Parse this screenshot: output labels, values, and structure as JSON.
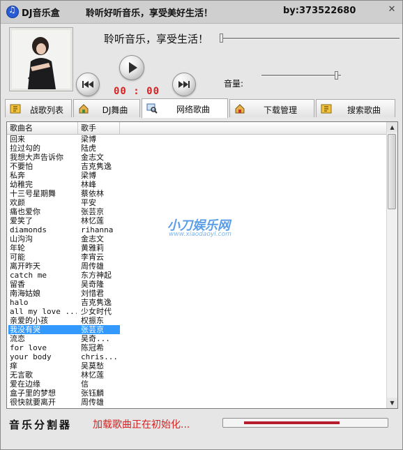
{
  "titlebar": {
    "app_title": "DJ音乐盒",
    "slogan": "聆听好听音乐，享受美好生活！",
    "author": "by:373522680",
    "close_glyph": "✕"
  },
  "player": {
    "lyric": "聆听音乐，享受生活！",
    "time": "00 : 00",
    "volume_label": "音量:",
    "progress": 0.0,
    "volume": 0.95
  },
  "tabs": [
    {
      "label": "战歌列表",
      "icon": "song-list-icon",
      "active": false
    },
    {
      "label": "DJ舞曲",
      "icon": "dj-house-icon",
      "active": false
    },
    {
      "label": "网络歌曲",
      "icon": "network-search-icon",
      "active": true
    },
    {
      "label": "下载管理",
      "icon": "download-house-icon",
      "active": false
    },
    {
      "label": "搜索歌曲",
      "icon": "search-list-icon",
      "active": false
    }
  ],
  "list": {
    "columns": [
      "歌曲名",
      "歌手"
    ],
    "rows": [
      [
        "回来",
        "梁博"
      ],
      [
        "拉过勾的",
        "陆虎"
      ],
      [
        "我想大声告诉你",
        "金志文"
      ],
      [
        "不要怕",
        "吉克隽逸"
      ],
      [
        "私奔",
        "梁博"
      ],
      [
        "幼稚完",
        "林峰"
      ],
      [
        "十三号星期舞",
        "蔡依林"
      ],
      [
        "欢颜",
        "平安"
      ],
      [
        "痛也爱你",
        "张芸京"
      ],
      [
        "爱笑了",
        "林忆莲"
      ],
      [
        "diamonds",
        "rihanna"
      ],
      [
        "山沟沟",
        "金志文"
      ],
      [
        "年轮",
        "黄雅莉"
      ],
      [
        "可能",
        "李宵云"
      ],
      [
        "离开昨天",
        "周传雄"
      ],
      [
        "catch me",
        "东方神起"
      ],
      [
        "留香",
        "吴奇隆"
      ],
      [
        "南海姑娘",
        "刘惜君"
      ],
      [
        "halo",
        "吉克隽逸"
      ],
      [
        "all my love ...",
        "少女时代"
      ],
      [
        "亲爱的小孩",
        "权振东"
      ],
      [
        "我没有哭",
        "张芸京"
      ],
      [
        "流恋",
        "吴奇..."
      ],
      [
        "for love",
        "陈冠希"
      ],
      [
        "your body",
        "chris..."
      ],
      [
        "痒",
        "吴莫愁"
      ],
      [
        "无言歌",
        "林忆莲"
      ],
      [
        "爱在边缘",
        "信"
      ],
      [
        "盒子里的梦想",
        "张钰麟"
      ],
      [
        "很快就要离开",
        "周传雄"
      ]
    ],
    "selected_index": 21,
    "watermark": "小刀娱乐网",
    "watermark_url": "www.xiaodaoyl.com"
  },
  "bottom": {
    "title": "音乐分割器",
    "status": "加载歌曲正在初始化...",
    "load_progress": 0.58
  },
  "colors": {
    "accent_red": "#d32323",
    "selection_blue": "#3399ff",
    "progress_red": "#b51c2e"
  }
}
